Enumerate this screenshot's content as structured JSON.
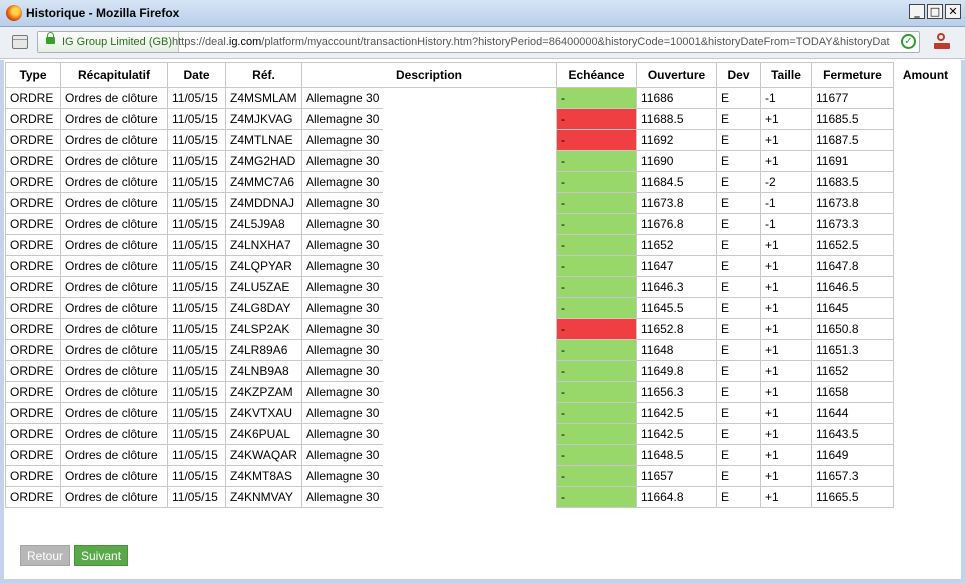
{
  "window": {
    "title": "Historique - Mozilla Firefox"
  },
  "urlbar": {
    "identity": "IG Group Limited (GB)",
    "url_prefix": "https://deal.",
    "url_domain": "ig.com",
    "url_suffix": "/platform/myaccount/transactionHistory.htm?historyPeriod=86400000&historyCode=10001&historyDateFrom=TODAY&historyDat"
  },
  "table": {
    "headers": {
      "type": "Type",
      "summary": "Récapitulatif",
      "date": "Date",
      "ref": "Réf.",
      "description": "Description",
      "expiry": "Echéance",
      "open": "Ouverture",
      "currency": "Dev",
      "size": "Taille",
      "close": "Fermeture",
      "amount": "Amount"
    },
    "status_colors": {
      "green": "#98d86a",
      "red": "#ef3f43"
    },
    "rows": [
      {
        "type": "ORDRE",
        "summary": "Ordres de clôture",
        "date": "11/05/15",
        "ref": "Z4MSMLAM",
        "description": "Allemagne 30",
        "expiry": "-",
        "status": "green",
        "open": "11686",
        "currency": "E",
        "size": "-1",
        "close": "11677"
      },
      {
        "type": "ORDRE",
        "summary": "Ordres de clôture",
        "date": "11/05/15",
        "ref": "Z4MJKVAG",
        "description": "Allemagne 30",
        "expiry": "-",
        "status": "red",
        "open": "11688.5",
        "currency": "E",
        "size": "+1",
        "close": "11685.5"
      },
      {
        "type": "ORDRE",
        "summary": "Ordres de clôture",
        "date": "11/05/15",
        "ref": "Z4MTLNAE",
        "description": "Allemagne 30",
        "expiry": "-",
        "status": "red",
        "open": "11692",
        "currency": "E",
        "size": "+1",
        "close": "11687.5"
      },
      {
        "type": "ORDRE",
        "summary": "Ordres de clôture",
        "date": "11/05/15",
        "ref": "Z4MG2HAD",
        "description": "Allemagne 30",
        "expiry": "-",
        "status": "green",
        "open": "11690",
        "currency": "E",
        "size": "+1",
        "close": "11691"
      },
      {
        "type": "ORDRE",
        "summary": "Ordres de clôture",
        "date": "11/05/15",
        "ref": "Z4MMC7A6",
        "description": "Allemagne 30",
        "expiry": "-",
        "status": "green",
        "open": "11684.5",
        "currency": "E",
        "size": "-2",
        "close": "11683.5"
      },
      {
        "type": "ORDRE",
        "summary": "Ordres de clôture",
        "date": "11/05/15",
        "ref": "Z4MDDNAJ",
        "description": "Allemagne 30",
        "expiry": "-",
        "status": "green",
        "open": "11673.8",
        "currency": "E",
        "size": "-1",
        "close": "11673.8"
      },
      {
        "type": "ORDRE",
        "summary": "Ordres de clôture",
        "date": "11/05/15",
        "ref": "Z4L5J9A8",
        "description": "Allemagne 30",
        "expiry": "-",
        "status": "green",
        "open": "11676.8",
        "currency": "E",
        "size": "-1",
        "close": "11673.3"
      },
      {
        "type": "ORDRE",
        "summary": "Ordres de clôture",
        "date": "11/05/15",
        "ref": "Z4LNXHA7",
        "description": "Allemagne 30",
        "expiry": "-",
        "status": "green",
        "open": "11652",
        "currency": "E",
        "size": "+1",
        "close": "11652.5"
      },
      {
        "type": "ORDRE",
        "summary": "Ordres de clôture",
        "date": "11/05/15",
        "ref": "Z4LQPYAR",
        "description": "Allemagne 30",
        "expiry": "-",
        "status": "green",
        "open": "11647",
        "currency": "E",
        "size": "+1",
        "close": "11647.8"
      },
      {
        "type": "ORDRE",
        "summary": "Ordres de clôture",
        "date": "11/05/15",
        "ref": "Z4LU5ZAE",
        "description": "Allemagne 30",
        "expiry": "-",
        "status": "green",
        "open": "11646.3",
        "currency": "E",
        "size": "+1",
        "close": "11646.5"
      },
      {
        "type": "ORDRE",
        "summary": "Ordres de clôture",
        "date": "11/05/15",
        "ref": "Z4LG8DAY",
        "description": "Allemagne 30",
        "expiry": "-",
        "status": "green",
        "open": "11645.5",
        "currency": "E",
        "size": "+1",
        "close": "11645"
      },
      {
        "type": "ORDRE",
        "summary": "Ordres de clôture",
        "date": "11/05/15",
        "ref": "Z4LSP2AK",
        "description": "Allemagne 30",
        "expiry": "-",
        "status": "red",
        "open": "11652.8",
        "currency": "E",
        "size": "+1",
        "close": "11650.8"
      },
      {
        "type": "ORDRE",
        "summary": "Ordres de clôture",
        "date": "11/05/15",
        "ref": "Z4LR89A6",
        "description": "Allemagne 30",
        "expiry": "-",
        "status": "green",
        "open": "11648",
        "currency": "E",
        "size": "+1",
        "close": "11651.3"
      },
      {
        "type": "ORDRE",
        "summary": "Ordres de clôture",
        "date": "11/05/15",
        "ref": "Z4LNB9A8",
        "description": "Allemagne 30",
        "expiry": "-",
        "status": "green",
        "open": "11649.8",
        "currency": "E",
        "size": "+1",
        "close": "11652"
      },
      {
        "type": "ORDRE",
        "summary": "Ordres de clôture",
        "date": "11/05/15",
        "ref": "Z4KZPZAM",
        "description": "Allemagne 30",
        "expiry": "-",
        "status": "green",
        "open": "11656.3",
        "currency": "E",
        "size": "+1",
        "close": "11658"
      },
      {
        "type": "ORDRE",
        "summary": "Ordres de clôture",
        "date": "11/05/15",
        "ref": "Z4KVTXAU",
        "description": "Allemagne 30",
        "expiry": "-",
        "status": "green",
        "open": "11642.5",
        "currency": "E",
        "size": "+1",
        "close": "11644"
      },
      {
        "type": "ORDRE",
        "summary": "Ordres de clôture",
        "date": "11/05/15",
        "ref": "Z4K6PUAL",
        "description": "Allemagne 30",
        "expiry": "-",
        "status": "green",
        "open": "11642.5",
        "currency": "E",
        "size": "+1",
        "close": "11643.5"
      },
      {
        "type": "ORDRE",
        "summary": "Ordres de clôture",
        "date": "11/05/15",
        "ref": "Z4KWAQAR",
        "description": "Allemagne 30",
        "expiry": "-",
        "status": "green",
        "open": "11648.5",
        "currency": "E",
        "size": "+1",
        "close": "11649"
      },
      {
        "type": "ORDRE",
        "summary": "Ordres de clôture",
        "date": "11/05/15",
        "ref": "Z4KMT8AS",
        "description": "Allemagne 30",
        "expiry": "-",
        "status": "green",
        "open": "11657",
        "currency": "E",
        "size": "+1",
        "close": "11657.3"
      },
      {
        "type": "ORDRE",
        "summary": "Ordres de clôture",
        "date": "11/05/15",
        "ref": "Z4KNMVAY",
        "description": "Allemagne 30",
        "expiry": "-",
        "status": "green",
        "open": "11664.8",
        "currency": "E",
        "size": "+1",
        "close": "11665.5"
      }
    ]
  },
  "buttons": {
    "back": "Retour",
    "next": "Suivant"
  }
}
